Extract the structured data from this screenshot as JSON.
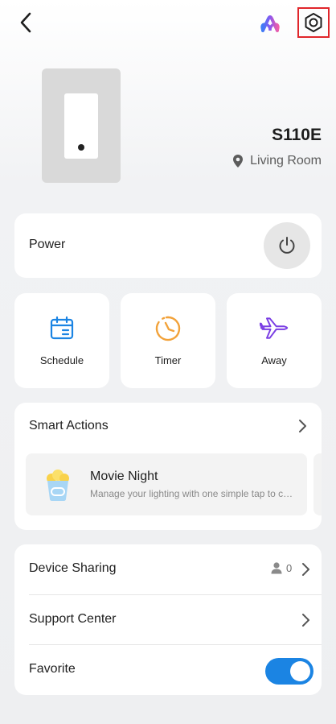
{
  "device": {
    "model": "S110E",
    "location": "Living Room"
  },
  "power": {
    "label": "Power"
  },
  "quick_actions": [
    {
      "label": "Schedule",
      "icon": "calendar-icon",
      "color": "#1b84e3"
    },
    {
      "label": "Timer",
      "icon": "clock-icon",
      "color": "#f2a23a"
    },
    {
      "label": "Away",
      "icon": "airplane-icon",
      "color": "#7b3fe4"
    }
  ],
  "smart_actions": {
    "title": "Smart Actions",
    "scene": {
      "title": "Movie Night",
      "description": "Manage your lighting with one simple tap to create the perfect movie atmosphere"
    }
  },
  "settings_list": {
    "device_sharing": {
      "label": "Device Sharing",
      "count": "0"
    },
    "support_center": {
      "label": "Support Center"
    },
    "favorite": {
      "label": "Favorite",
      "enabled": true
    }
  },
  "colors": {
    "accent": "#1b84e3",
    "highlight_border": "#e0262b"
  }
}
